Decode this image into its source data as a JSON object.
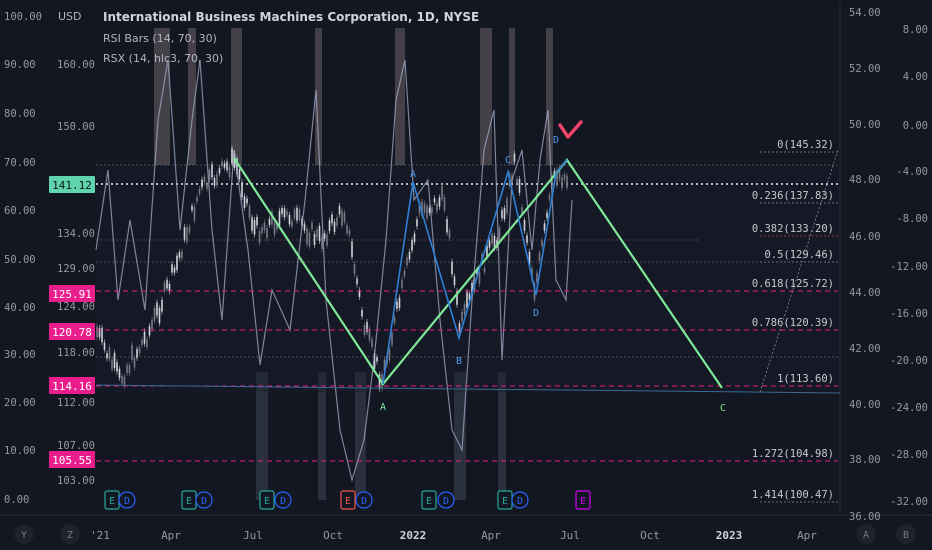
{
  "header": {
    "currency": "USD",
    "title": "International Business Machines Corporation, 1D, NYSE",
    "indicators": [
      "RSI Bars (14, 70, 30)",
      "RSX (14, hlc3, 70, 30)"
    ]
  },
  "axes": {
    "rsi_left": [
      "100.00",
      "90.00",
      "80.00",
      "70.00",
      "60.00",
      "50.00",
      "40.00",
      "30.00",
      "20.00",
      "10.00",
      "0.00"
    ],
    "price_inner": [
      "160.00",
      "150.00",
      "134.00",
      "129.00",
      "124.00",
      "118.00",
      "112.00",
      "107.00",
      "103.00"
    ],
    "right_outer": [
      "54.00",
      "52.00",
      "50.00",
      "48.00",
      "46.00",
      "44.00",
      "42.00",
      "40.00",
      "38.00",
      "36.00"
    ],
    "right_inner": [
      "8.00",
      "4.00",
      "0.00",
      "-4.00",
      "-8.00",
      "-12.00",
      "-16.00",
      "-20.00",
      "-24.00",
      "-28.00",
      "-32.00"
    ],
    "time": [
      "'21",
      "Apr",
      "Jul",
      "Oct",
      "2022",
      "Apr",
      "Jul",
      "Oct",
      "2023",
      "Apr"
    ],
    "corner_left": [
      "Y",
      "Z"
    ],
    "corner_right": [
      "A",
      "B"
    ]
  },
  "price_tags": [
    {
      "text": "141.12",
      "color": "#5fd4ae"
    },
    {
      "text": "125.91",
      "color": "#e91e8c"
    },
    {
      "text": "120.78",
      "color": "#e91e8c"
    },
    {
      "text": "114.16",
      "color": "#e91e8c"
    },
    {
      "text": "105.55",
      "color": "#e91e8c"
    }
  ],
  "fib_levels": [
    "0(145.32)",
    "0.236(137.83)",
    "0.382(133.20)",
    "0.5(129.46)",
    "0.618(125.72)",
    "0.786(120.39)",
    "1(113.60)",
    "1.272(104.98)",
    "1.414(100.47)"
  ],
  "wave_labels": {
    "green": [
      "A",
      "C"
    ],
    "blue": [
      "A",
      "B",
      "C",
      "D",
      "D",
      "B"
    ]
  },
  "event_markers": [
    "E",
    "D",
    "E",
    "D",
    "E",
    "D",
    "E",
    "D",
    "E",
    "D",
    "E",
    "D",
    "E"
  ],
  "colors": {
    "background": "#131722",
    "green_wave": "#7ee897",
    "blue_wave": "#2f7fd6",
    "fib_line": "#e91e8c",
    "accent_tag": "#5fd4ae",
    "target_mark": "#f2436b"
  }
}
